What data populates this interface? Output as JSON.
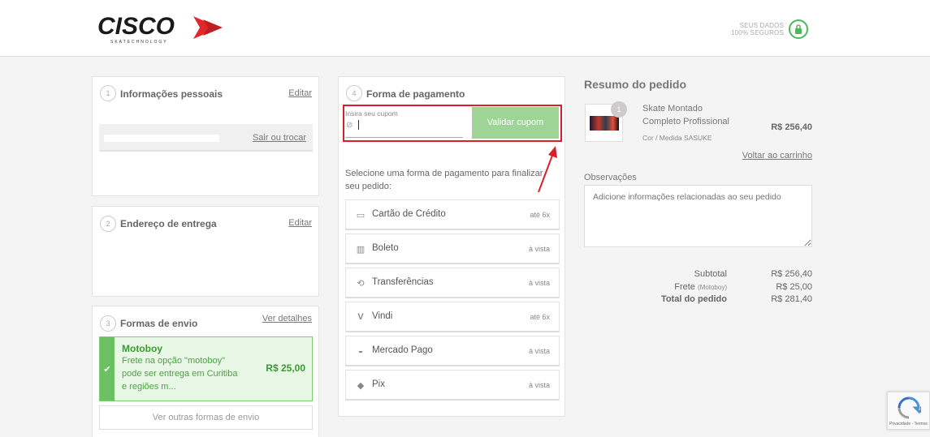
{
  "header": {
    "logo_text": "CISCO",
    "logo_tagline": "SKATECHNOLOGY",
    "secure_line1": "SEUS DADOS",
    "secure_line2": "100% SEGUROS"
  },
  "personal": {
    "step": "1",
    "title": "Informações pessoais",
    "edit": "Editar",
    "logout": "Sair ou trocar"
  },
  "address": {
    "step": "2",
    "title": "Endereço de entrega",
    "edit": "Editar"
  },
  "shipping": {
    "step": "3",
    "title": "Formas de envio",
    "details": "Ver detalhes",
    "option_name": "Motoboy",
    "option_desc_1": "Frete na opção \"motoboy\"",
    "option_desc_2": "pode ser entrega em Curitiba",
    "option_desc_3": "e regiões m...",
    "option_price": "R$ 25,00",
    "other_options": "Ver outras formas de envio"
  },
  "payment": {
    "step": "4",
    "title": "Forma de pagamento",
    "coupon_label": "Insira seu cupom",
    "coupon_button": "Validar cupom",
    "instructions": "Selecione uma forma de pagamento para finalizar seu pedido:",
    "methods": [
      {
        "label": "Cartão de Crédito",
        "note": "até 6x",
        "icon": "credit-card-icon"
      },
      {
        "label": "Boleto",
        "note": "à vista",
        "icon": "barcode-icon"
      },
      {
        "label": "Transferências",
        "note": "à vista",
        "icon": "transfer-icon"
      },
      {
        "label": "Vindi",
        "note": "até 6x",
        "icon": "vindi-icon"
      },
      {
        "label": "Mercado Pago",
        "note": "à vista",
        "icon": "mercado-pago-icon"
      },
      {
        "label": "Pix",
        "note": "à vista",
        "icon": "pix-icon"
      }
    ]
  },
  "summary": {
    "title": "Resumo do pedido",
    "item_qty": "1",
    "item_name_1": "Skate Montado",
    "item_name_2": "Completo Profissional",
    "item_variant": "Cor / Medida SASUKE",
    "item_price": "R$ 256,40",
    "back_to_cart": "Voltar ao carrinho",
    "notes_label": "Observações",
    "notes_placeholder": "Adicione informações relacionadas ao seu pedido",
    "subtotal_label": "Subtotal",
    "subtotal_value": "R$ 256,40",
    "shipping_label": "Frete",
    "shipping_method": "(Motoboy)",
    "shipping_value": "R$ 25,00",
    "total_label": "Total do pedido",
    "total_value": "R$ 281,40"
  },
  "recaptcha": {
    "text": "Privacidade - Termos"
  },
  "colors": {
    "brand_red": "#e1262c",
    "accent_green": "#6bc162",
    "highlight_red": "#d9202a"
  }
}
